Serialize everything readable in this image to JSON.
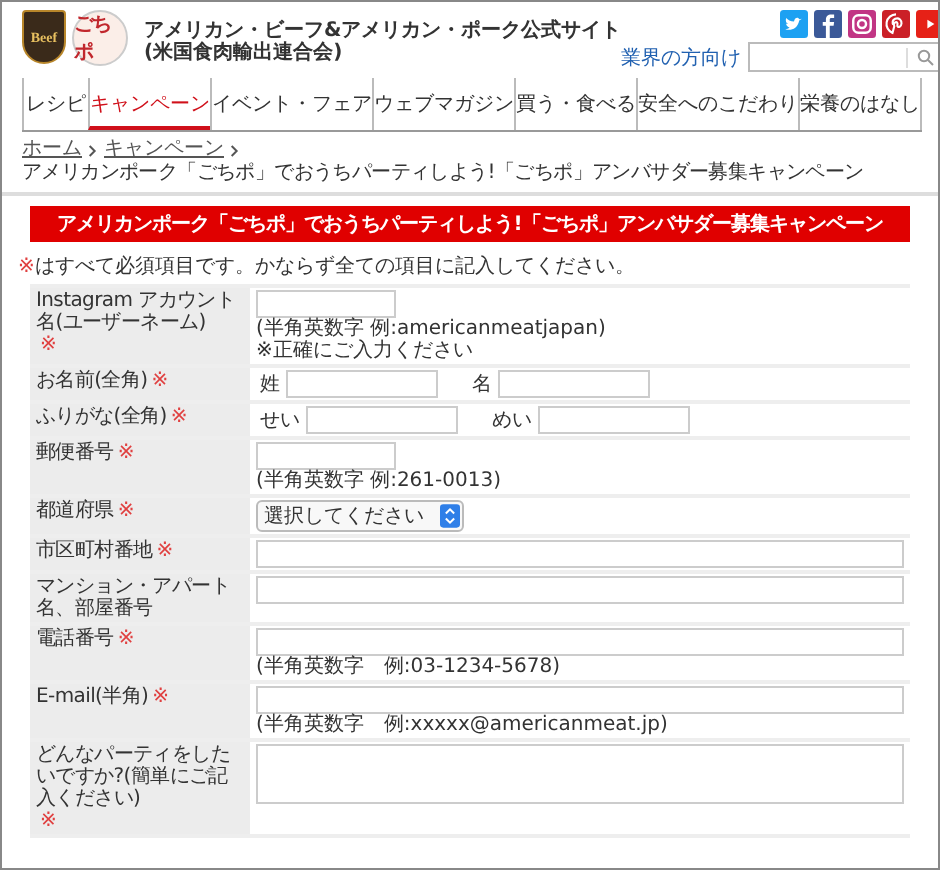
{
  "header": {
    "logos": [
      {
        "kind": "beef",
        "text": "Beef"
      },
      {
        "kind": "gochipo",
        "text": "ごちポ"
      }
    ],
    "title_lines": [
      "アメリカン・ビーフ&アメリカン・ポーク公式サイト",
      "(米国食肉輸出連合会)"
    ],
    "social": [
      {
        "kind": "twitter"
      },
      {
        "kind": "facebook"
      },
      {
        "kind": "instagram"
      },
      {
        "kind": "pinterest"
      },
      {
        "kind": "youtube"
      }
    ],
    "industry_link": "業界の方向け"
  },
  "nav": [
    {
      "label": "レシピ",
      "selected": false
    },
    {
      "label": "キャンペーン",
      "selected": true
    },
    {
      "label": "イベント・フェア",
      "selected": false
    },
    {
      "label": "ウェブマガジン",
      "selected": false
    },
    {
      "label": "買う・食べる",
      "selected": false
    },
    {
      "label": "安全へのこだわり",
      "selected": false
    },
    {
      "label": "栄養のはなし",
      "selected": false
    }
  ],
  "breadcrumb": [
    "ホーム",
    "キャンペーン",
    "アメリカンポーク「ごちポ」でおうちパーティしよう!「ごちポ」アンバサダー募集キャンペーン"
  ],
  "banner": "アメリカンポーク「ごちポ」でおうちパーティしよう!「ごちポ」アンバサダー募集キャンペーン",
  "required_mark": "※",
  "note": "はすべて必須項目です。かならず全ての項目に記入してください。",
  "rows": [
    {
      "label": "Instagram アカウント名(ユーザーネーム)",
      "required": true,
      "kind": "short",
      "notes": [
        "(半角英数字 例:americanmeatjapan)",
        "※正確にご入力ください"
      ]
    },
    {
      "label": "お名前(全角)",
      "required": true,
      "kind": "pair",
      "parts": [
        "姓",
        "名"
      ]
    },
    {
      "label": "ふりがな(全角)",
      "required": true,
      "kind": "pair",
      "parts": [
        "せい",
        "めい"
      ]
    },
    {
      "label": "郵便番号",
      "required": true,
      "kind": "short",
      "notes": [
        "(半角英数字 例:261-0013)"
      ]
    },
    {
      "label": "都道府県",
      "required": true,
      "kind": "select",
      "value": "選択してください"
    },
    {
      "label": "市区町村番地",
      "required": true,
      "kind": "full"
    },
    {
      "label": "マンション・アパート名、部屋番号",
      "required": false,
      "kind": "full"
    },
    {
      "label": "電話番号",
      "required": true,
      "kind": "full",
      "notes": [
        "(半角英数字　例:03-1234-5678)"
      ]
    },
    {
      "label": "E-mail(半角)",
      "required": true,
      "kind": "full",
      "notes": [
        "(半角英数字　例:xxxxx@americanmeat.jp)"
      ]
    },
    {
      "label": "どんなパーティをしたいですか?(簡単にご記入ください)",
      "required": true,
      "kind": "textarea"
    }
  ]
}
